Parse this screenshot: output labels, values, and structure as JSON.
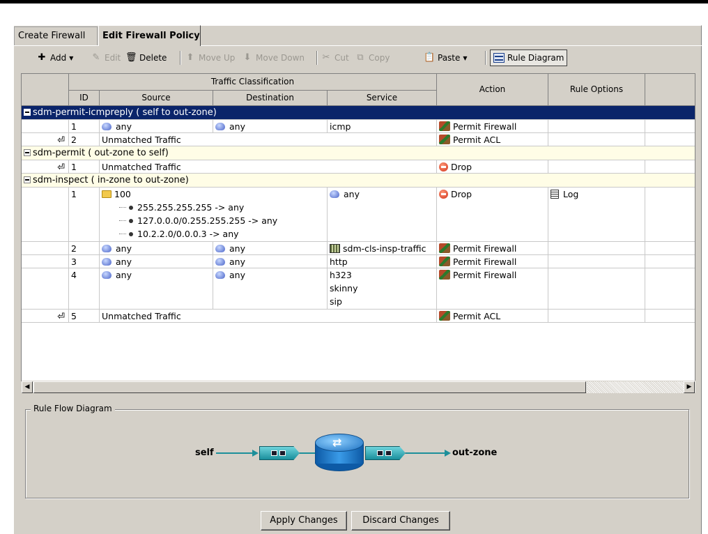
{
  "tabs": [
    {
      "label": "Create Firewall",
      "active": false
    },
    {
      "label": "Edit Firewall Policy",
      "active": true
    }
  ],
  "toolbar": {
    "add": "Add",
    "edit": "Edit",
    "delete": "Delete",
    "move_up": "Move Up",
    "move_down": "Move Down",
    "cut": "Cut",
    "copy": "Copy",
    "paste": "Paste",
    "rule_diagram": "Rule Diagram"
  },
  "table": {
    "group_header": "Traffic Classification",
    "columns": {
      "id": "ID",
      "source": "Source",
      "destination": "Destination",
      "service": "Service",
      "action": "Action",
      "rule_options": "Rule Options"
    },
    "groups": [
      {
        "name": "sdm-permit-icmpreply",
        "zones": "( self  to  out-zone)",
        "selected": true,
        "rows": [
          {
            "id": "1",
            "source": "any",
            "destination": "any",
            "service": "icmp",
            "action": "Permit Firewall"
          },
          {
            "id": "2",
            "source": "Unmatched Traffic",
            "action": "Permit ACL"
          }
        ]
      },
      {
        "name": "sdm-permit",
        "zones": "( out-zone  to  self)",
        "selected": false,
        "rows": [
          {
            "id": "1",
            "source": "Unmatched Traffic",
            "action": "Drop"
          }
        ]
      },
      {
        "name": "sdm-inspect",
        "zones": "( in-zone  to  out-zone)",
        "selected": false,
        "rows": [
          {
            "id": "1",
            "source": "100",
            "source_entries": [
              "255.255.255.255 -> any",
              "127.0.0.0/0.255.255.255 -> any",
              "10.2.2.0/0.0.0.3 -> any"
            ],
            "service": "any",
            "action": "Drop",
            "rule_options": "Log"
          },
          {
            "id": "2",
            "source": "any",
            "destination": "any",
            "service": "sdm-cls-insp-traffic",
            "action": "Permit Firewall"
          },
          {
            "id": "3",
            "source": "any",
            "destination": "any",
            "service": "http",
            "action": "Permit Firewall"
          },
          {
            "id": "4",
            "source": "any",
            "destination": "any",
            "service_lines": [
              "h323",
              "skinny",
              "sip"
            ],
            "action": "Permit Firewall"
          },
          {
            "id": "5",
            "source": "Unmatched Traffic",
            "action": "Permit ACL"
          }
        ]
      }
    ]
  },
  "diagram": {
    "legend": "Rule Flow Diagram",
    "source_zone": "self",
    "dest_zone": "out-zone"
  },
  "buttons": {
    "apply": "Apply Changes",
    "discard": "Discard Changes"
  },
  "colors": {
    "selection": "#0a246a",
    "group_row": "#fffde6",
    "panel": "#d4d0c8",
    "flow_line": "#1c8f9a"
  }
}
